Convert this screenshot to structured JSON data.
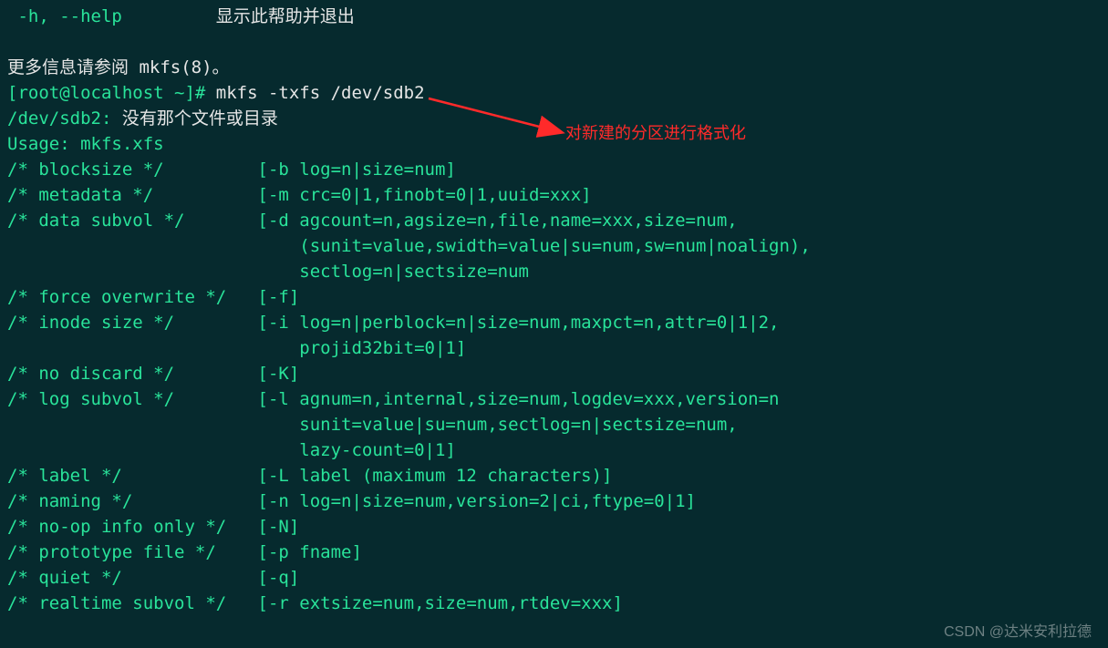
{
  "lines": [
    {
      "segments": [
        {
          "cls": "",
          "text": " -h, --help         "
        },
        {
          "cls": "white",
          "text": "显示此帮助并退出"
        }
      ]
    },
    {
      "segments": [
        {
          "cls": "",
          "text": ""
        }
      ]
    },
    {
      "segments": [
        {
          "cls": "white",
          "text": "更多信息请参阅 mkfs(8)。"
        }
      ]
    },
    {
      "segments": [
        {
          "cls": "",
          "text": "[root@localhost ~]# "
        },
        {
          "cls": "white",
          "text": "mkfs -txfs /dev/sdb2"
        }
      ]
    },
    {
      "segments": [
        {
          "cls": "",
          "text": "/dev/sdb2: "
        },
        {
          "cls": "white",
          "text": "没有那个文件或目录"
        }
      ]
    },
    {
      "segments": [
        {
          "cls": "",
          "text": "Usage: mkfs.xfs"
        }
      ]
    },
    {
      "segments": [
        {
          "cls": "",
          "text": "/* blocksize */         [-b log=n|size=num]"
        }
      ]
    },
    {
      "segments": [
        {
          "cls": "",
          "text": "/* metadata */          [-m crc=0|1,finobt=0|1,uuid=xxx]"
        }
      ]
    },
    {
      "segments": [
        {
          "cls": "",
          "text": "/* data subvol */       [-d agcount=n,agsize=n,file,name=xxx,size=num,"
        }
      ]
    },
    {
      "segments": [
        {
          "cls": "",
          "text": "                            (sunit=value,swidth=value|su=num,sw=num|noalign),"
        }
      ]
    },
    {
      "segments": [
        {
          "cls": "",
          "text": "                            sectlog=n|sectsize=num"
        }
      ]
    },
    {
      "segments": [
        {
          "cls": "",
          "text": "/* force overwrite */   [-f]"
        }
      ]
    },
    {
      "segments": [
        {
          "cls": "",
          "text": "/* inode size */        [-i log=n|perblock=n|size=num,maxpct=n,attr=0|1|2,"
        }
      ]
    },
    {
      "segments": [
        {
          "cls": "",
          "text": "                            projid32bit=0|1]"
        }
      ]
    },
    {
      "segments": [
        {
          "cls": "",
          "text": "/* no discard */        [-K]"
        }
      ]
    },
    {
      "segments": [
        {
          "cls": "",
          "text": "/* log subvol */        [-l agnum=n,internal,size=num,logdev=xxx,version=n"
        }
      ]
    },
    {
      "segments": [
        {
          "cls": "",
          "text": "                            sunit=value|su=num,sectlog=n|sectsize=num,"
        }
      ]
    },
    {
      "segments": [
        {
          "cls": "",
          "text": "                            lazy-count=0|1]"
        }
      ]
    },
    {
      "segments": [
        {
          "cls": "",
          "text": "/* label */             [-L label (maximum 12 characters)]"
        }
      ]
    },
    {
      "segments": [
        {
          "cls": "",
          "text": "/* naming */            [-n log=n|size=num,version=2|ci,ftype=0|1]"
        }
      ]
    },
    {
      "segments": [
        {
          "cls": "",
          "text": "/* no-op info only */   [-N]"
        }
      ]
    },
    {
      "segments": [
        {
          "cls": "",
          "text": "/* prototype file */    [-p fname]"
        }
      ]
    },
    {
      "segments": [
        {
          "cls": "",
          "text": "/* quiet */             [-q]"
        }
      ]
    },
    {
      "segments": [
        {
          "cls": "",
          "text": "/* realtime subvol */   [-r extsize=num,size=num,rtdev=xxx]"
        }
      ]
    }
  ],
  "annotation": {
    "text": "对新建的分区进行格式化",
    "arrow_color": "#ff2a2a"
  },
  "watermark": "CSDN @达米安利拉德"
}
